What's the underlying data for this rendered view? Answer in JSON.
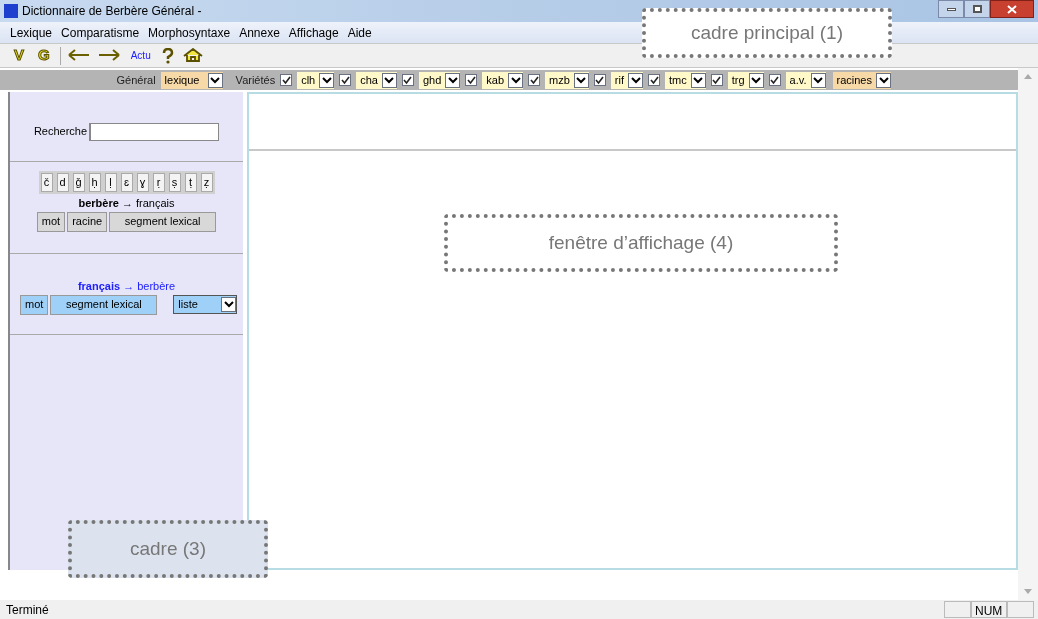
{
  "window": {
    "title": "Dictionnaire de Berbère Général -"
  },
  "menu": [
    {
      "label": "Lexique"
    },
    {
      "label": "Comparatisme"
    },
    {
      "label": "Morphosyntaxe"
    },
    {
      "label": "Annexe"
    },
    {
      "label": "Affichage"
    },
    {
      "label": "Aide"
    }
  ],
  "toolbar": [
    {
      "kind": "letter",
      "label": "V"
    },
    {
      "kind": "letter",
      "label": "G"
    },
    {
      "kind": "back"
    },
    {
      "kind": "forward"
    },
    {
      "kind": "text",
      "label": "Actu"
    },
    {
      "kind": "help"
    },
    {
      "kind": "home"
    }
  ],
  "filter_bar": {
    "general_label": "Général",
    "general_value": "lexique",
    "varietes_label": "Variétés",
    "varieties": [
      {
        "label": "clh",
        "checked": true
      },
      {
        "label": "cha",
        "checked": true
      },
      {
        "label": "ghd",
        "checked": true
      },
      {
        "label": "kab",
        "checked": true
      },
      {
        "label": "mzb",
        "checked": true
      },
      {
        "label": "rif",
        "checked": true
      },
      {
        "label": "tmc",
        "checked": true
      },
      {
        "label": "trg",
        "checked": true
      },
      {
        "label": "a.v.",
        "checked": true
      }
    ],
    "roots_value": "racines"
  },
  "sidebar": {
    "search_label": "Recherche",
    "letters": [
      "č",
      "d",
      "ǧ",
      "ḥ",
      "ḷ",
      "ɛ",
      "ɣ",
      "ṛ",
      "ṣ",
      "ṭ",
      "ẓ"
    ],
    "berbere": {
      "source": "berbère",
      "arrow": "→",
      "target": "français",
      "buttons": [
        "mot",
        "racine",
        "segment lexical"
      ]
    },
    "francais": {
      "source": "français",
      "arrow": "→",
      "target": "berbère",
      "buttons": [
        "mot",
        "segment lexical"
      ],
      "list_value": "liste"
    }
  },
  "callouts": [
    {
      "label": "cadre principal  (1)",
      "kind": "white"
    },
    {
      "label": "fenêtre d’affichage  (4)",
      "kind": "white"
    },
    {
      "label": "cadre (3)",
      "kind": "shaded"
    }
  ],
  "status_bar": {
    "text": "Terminé",
    "num": "NUM"
  }
}
